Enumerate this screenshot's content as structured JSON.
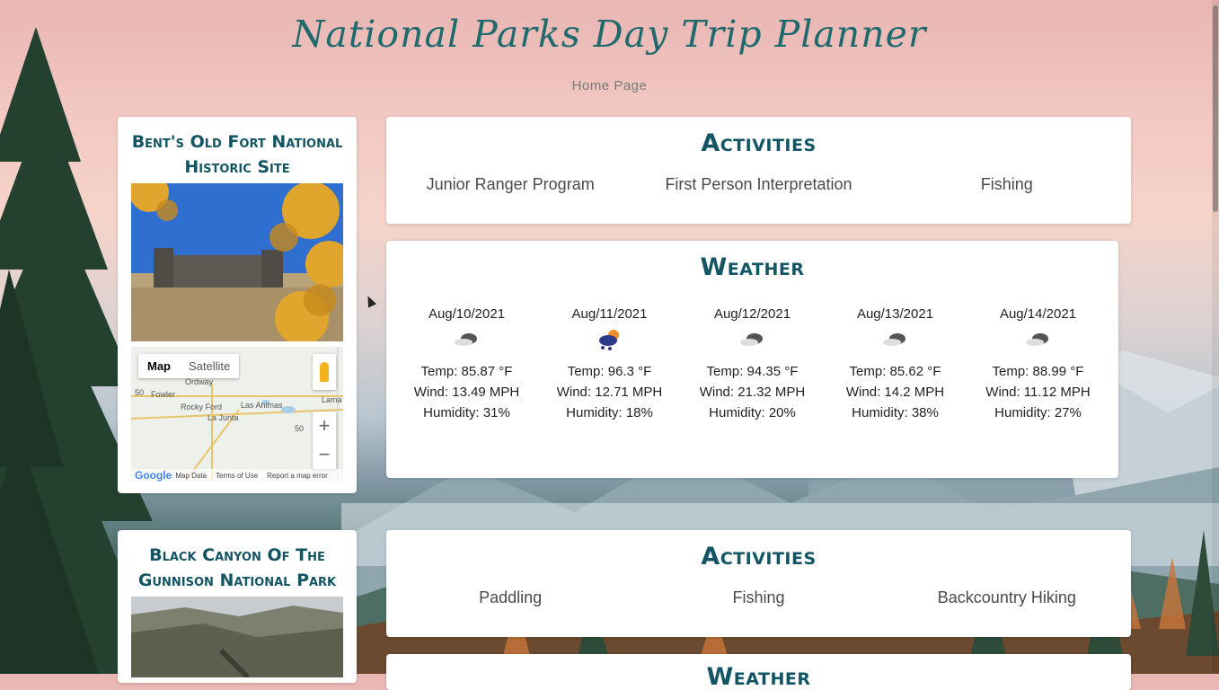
{
  "header": {
    "title": "National Parks Day Trip Planner",
    "subtitle": "Home Page"
  },
  "parks": [
    {
      "name": "Bent's Old Fort National Historic Site",
      "activities_title": "Activities",
      "activities": [
        "Junior Ranger Program",
        "First Person Interpretation",
        "Fishing"
      ],
      "weather_title": "Weather",
      "forecast": [
        {
          "date": "Aug/10/2021",
          "icon": "cloud-icon",
          "temp": "Temp: 85.87 °F",
          "wind": "Wind: 13.49 MPH",
          "humidity": "Humidity: 31%"
        },
        {
          "date": "Aug/11/2021",
          "icon": "storm-icon",
          "temp": "Temp: 96.3 °F",
          "wind": "Wind: 12.71 MPH",
          "humidity": "Humidity: 18%"
        },
        {
          "date": "Aug/12/2021",
          "icon": "cloud-icon",
          "temp": "Temp: 94.35 °F",
          "wind": "Wind: 21.32 MPH",
          "humidity": "Humidity: 20%"
        },
        {
          "date": "Aug/13/2021",
          "icon": "cloud-icon",
          "temp": "Temp: 85.62 °F",
          "wind": "Wind: 14.2 MPH",
          "humidity": "Humidity: 38%"
        },
        {
          "date": "Aug/14/2021",
          "icon": "cloud-icon",
          "temp": "Temp: 88.99 °F",
          "wind": "Wind: 11.12 MPH",
          "humidity": "Humidity: 27%"
        }
      ],
      "map": {
        "tab_map": "Map",
        "tab_satellite": "Satellite",
        "zoom_in": "+",
        "zoom_out": "−",
        "labels": [
          "Fowler",
          "Rocky Ford",
          "Las Animas",
          "La Junta",
          "Lama",
          "Ordway",
          "50",
          "50"
        ],
        "footer": {
          "logo": "Google",
          "map_data": "Map Data",
          "terms": "Terms of Use",
          "report": "Report a map error"
        }
      }
    },
    {
      "name": "Black Canyon Of The Gunnison National Park",
      "activities_title": "Activities",
      "activities": [
        "Paddling",
        "Fishing",
        "Backcountry Hiking"
      ],
      "weather_title": "Weather"
    }
  ]
}
